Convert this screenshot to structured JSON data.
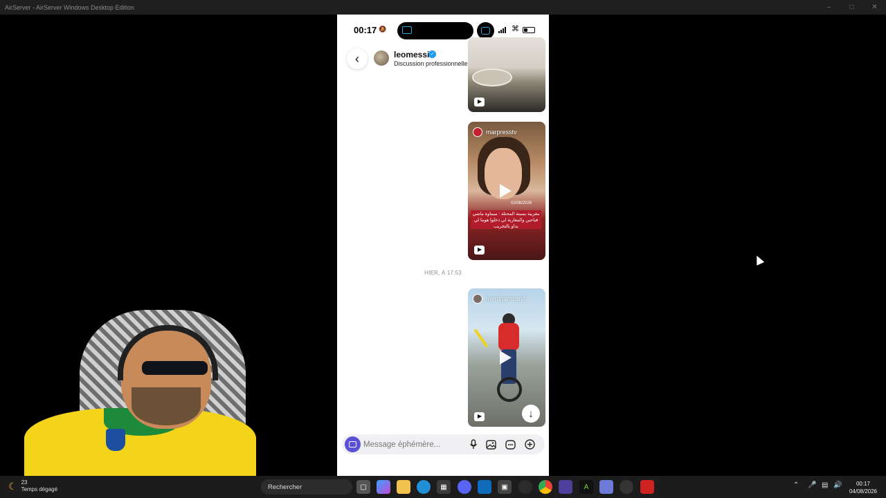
{
  "window": {
    "title": "AirServer - AirServer Windows Desktop Edition",
    "controls": [
      "minimize-icon",
      "maximize-icon",
      "close-icon"
    ]
  },
  "phone": {
    "status_bar": {
      "time": "00:17",
      "battery_level": 0.3
    },
    "chat_header": {
      "username": "leomessi",
      "verified": true,
      "subtitle": "Discussion professionnelle"
    },
    "messages": [
      {
        "type": "reel",
        "author": "",
        "badge": "reel-icon"
      },
      {
        "type": "reel",
        "author": "marpresstv",
        "date": "02/08/2026",
        "caption": "مغربية بسبتة المحتلة : سبتاوة ماشي فباحين والمغاربة لي دخلوا هوما لي بداو بالتخريب",
        "badge": "reel-icon"
      },
      {
        "type": "timestamp",
        "text": "HIER, À 17:53"
      },
      {
        "type": "reel",
        "author": "merdhamza04",
        "badge": "reel-icon"
      }
    ],
    "composer": {
      "placeholder": "Message éphémère...",
      "icons": [
        "microphone-icon",
        "image-icon",
        "sticker-icon",
        "plus-icon"
      ]
    }
  },
  "taskbar": {
    "weather": {
      "temp": "23",
      "label": "Temps dégagé"
    },
    "search_placeholder": "Rechercher",
    "clock": {
      "time": "00:17",
      "date": "04/08/2026"
    },
    "accent": "#5b51d8"
  }
}
